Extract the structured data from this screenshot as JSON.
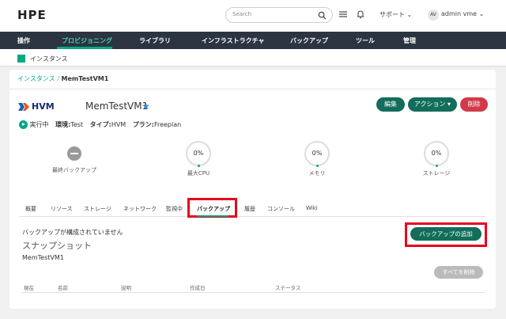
{
  "header": {
    "logo": "HPE",
    "search_placeholder": "Search",
    "support": "サポート",
    "avatar_initials": "AV",
    "username": "admin vme"
  },
  "nav": {
    "items": [
      "操作",
      "プロビジョニング",
      "ライブラリ",
      "インフラストラクチャ",
      "バックアップ",
      "ツール",
      "管理"
    ],
    "active_index": 1
  },
  "subheader": {
    "title": "インスタンス"
  },
  "breadcrumb": {
    "parent": "インスタンス",
    "sep": "/",
    "current": "MemTestVM1"
  },
  "instance": {
    "type_logo": "HVM",
    "name": "MemTestVM1",
    "star": "★",
    "actions": {
      "edit": "編集",
      "action": "アクション ▾",
      "delete": "削除"
    },
    "status": {
      "state": "実行中",
      "env_label": "環境:",
      "env_value": "Test",
      "type_label": "タイプ:",
      "type_value": "HVM",
      "plan_label": "プラン:",
      "plan_value": "Freeplan"
    }
  },
  "metrics": [
    {
      "label": "最終バックアップ",
      "value": ""
    },
    {
      "label": "最大CPU",
      "value": "0%"
    },
    {
      "label": "メモリ",
      "value": "0%"
    },
    {
      "label": "ストレージ",
      "value": "0%"
    }
  ],
  "tabs": [
    "概要",
    "リソース",
    "ストレージ",
    "ネットワーク",
    "監視中",
    "バックアップ",
    "履歴",
    "コンソール",
    "Wiki"
  ],
  "active_tab": "バックアップ",
  "backups": {
    "empty_message": "バックアップが構成されていません",
    "add_button": "バックアップの追加",
    "snapshots_title": "スナップショット",
    "vm_name": "MemTestVM1",
    "delete_all": "すべてを削除",
    "columns": [
      "現在",
      "名前",
      "説明",
      "作成日",
      "ステータス"
    ]
  },
  "colors": {
    "accent": "#01a982",
    "nav_bg": "#2b3440",
    "button": "#136d5b",
    "danger": "#d03a4a",
    "highlight": "#e8001c"
  }
}
